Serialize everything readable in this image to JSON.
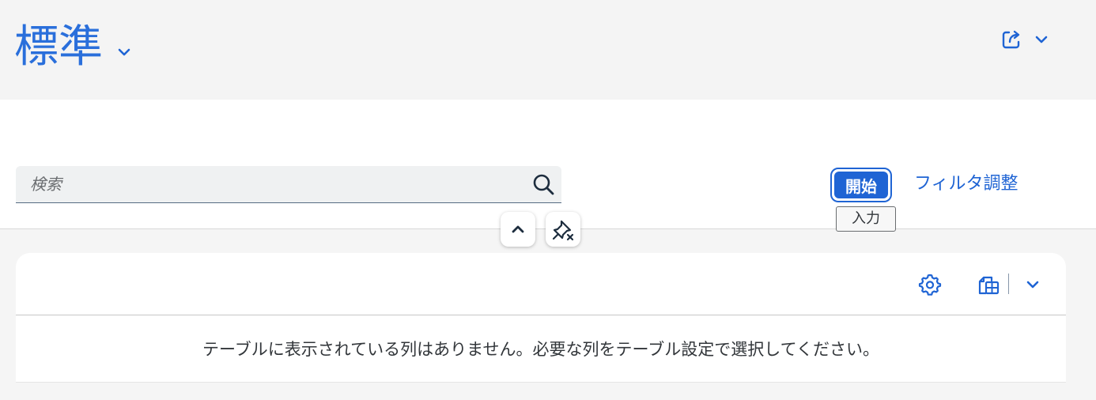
{
  "header": {
    "variant_title": "標準"
  },
  "filter_bar": {
    "search_placeholder": "検索",
    "go_label": "開始",
    "adapt_filters_label": "フィルタ調整",
    "tooltip": "入力"
  },
  "table": {
    "no_data_text": "テーブルに表示されている列はありません。必要な列をテーブル設定で選択してください。"
  },
  "colors": {
    "accent": "#1f64d4",
    "title": "#2a6fdb",
    "text": "#32363a",
    "header_bg": "#f4f4f4"
  },
  "icons": {
    "variant_dropdown": "chevron-down-icon",
    "share": "share-icon",
    "share_menu": "chevron-down-icon",
    "search": "search-icon",
    "collapse": "chevron-up-icon",
    "pin": "unpin-icon",
    "settings": "gear-icon",
    "export": "export-spreadsheet-icon",
    "export_menu": "chevron-down-icon"
  }
}
